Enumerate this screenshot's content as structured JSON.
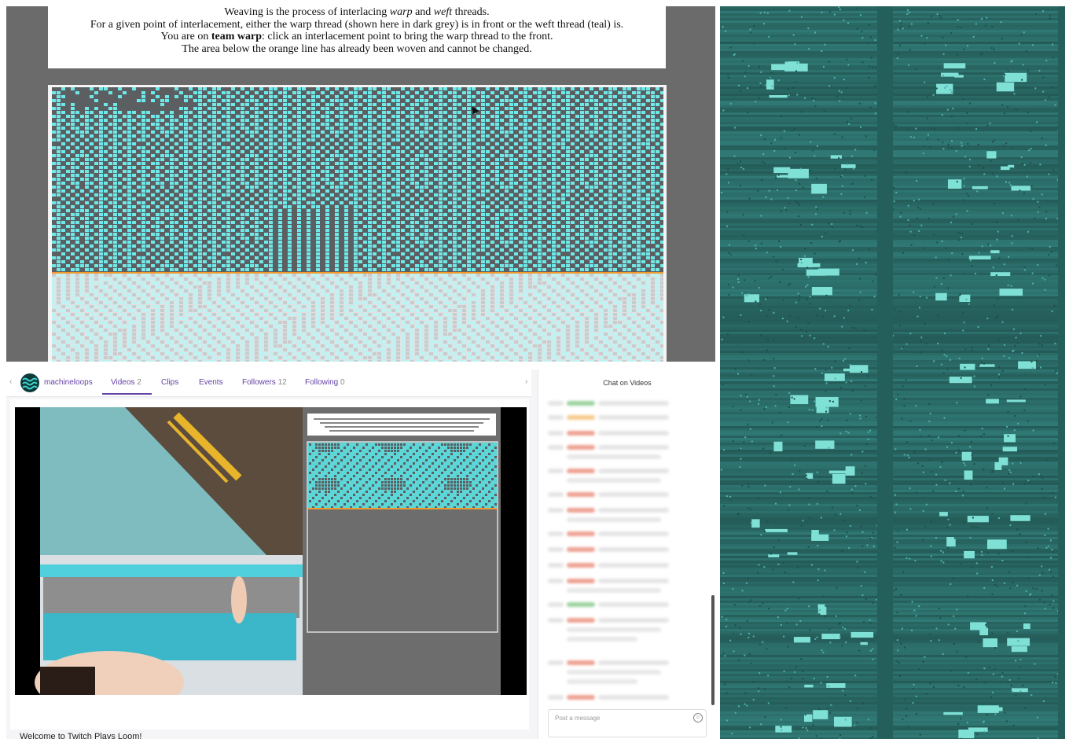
{
  "weave_app": {
    "line1_pre": "Weaving is the process of interlacing ",
    "line1_warp": "warp",
    "line1_mid": " and ",
    "line1_weft": "weft",
    "line1_post": " threads.",
    "line2": "For a given point of interlacement, either the warp thread (shown here in dark grey) is in front or the weft thread (teal) is.",
    "line3_pre": "You are on ",
    "line3_team": "team warp",
    "line3_post": ": click an interlacement point to bring the warp thread to the front.",
    "line4": "The area below the orange line has already been woven and cannot be changed.",
    "colors": {
      "warp": "#5c5f62",
      "weft": "#6ee8e8",
      "boundary": "#f29a2e"
    }
  },
  "twitch": {
    "channel_name": "machineloops",
    "tabs": [
      {
        "label": "Videos",
        "count": "2"
      },
      {
        "label": "Clips",
        "count": ""
      },
      {
        "label": "Events",
        "count": ""
      },
      {
        "label": "Followers",
        "count": "12"
      },
      {
        "label": "Following",
        "count": "0"
      }
    ],
    "nav_left": "‹",
    "nav_right": "›",
    "video_caption": "Welcome to Twitch Plays Loom!",
    "chat_title": "Chat on Videos",
    "chat_placeholder": "Post a message",
    "accent": "#6441a4"
  },
  "fabric_photo": {
    "icon": "woven-fabric-image",
    "color": "#2a6a66"
  }
}
